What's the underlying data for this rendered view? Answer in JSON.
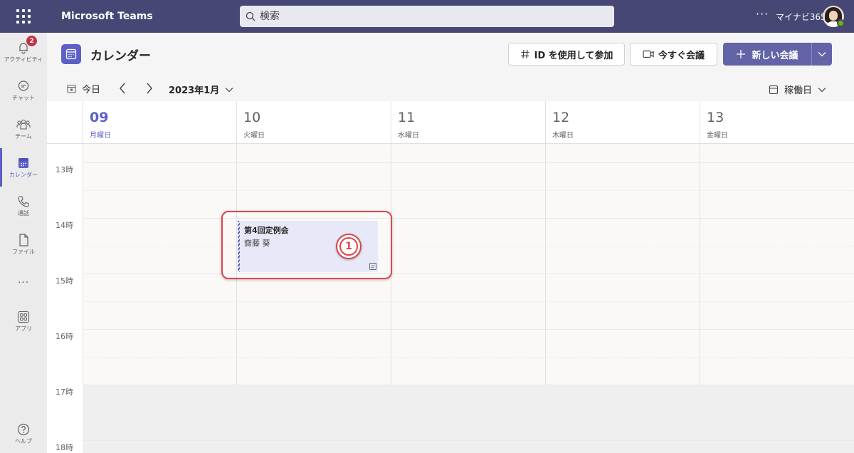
{
  "topbar": {
    "app_title": "Microsoft Teams",
    "search_placeholder": "検索",
    "more": "···",
    "user_name": "マイナビ365"
  },
  "rail": {
    "activity_badge": "2",
    "items": [
      {
        "label": "アクティビティ",
        "icon": "bell-icon"
      },
      {
        "label": "チャット",
        "icon": "chat-icon"
      },
      {
        "label": "チーム",
        "icon": "teams-icon"
      },
      {
        "label": "カレンダー",
        "icon": "calendar-icon"
      },
      {
        "label": "通話",
        "icon": "phone-icon"
      },
      {
        "label": "ファイル",
        "icon": "file-icon"
      },
      {
        "label": "···",
        "icon": "more-icon"
      },
      {
        "label": "アプリ",
        "icon": "apps-icon"
      },
      {
        "label": "ヘルプ",
        "icon": "help-icon"
      }
    ]
  },
  "header": {
    "title": "カレンダー",
    "join_label": "ID を使用して参加",
    "meet_now_label": "今すぐ会議",
    "new_meeting_label": "新しい会議"
  },
  "toolbar": {
    "today_label": "今日",
    "month_label": "2023年1月",
    "view_label": "稼働日"
  },
  "days": [
    {
      "num": "09",
      "name": "月曜日"
    },
    {
      "num": "10",
      "name": "火曜日"
    },
    {
      "num": "11",
      "name": "水曜日"
    },
    {
      "num": "12",
      "name": "木曜日"
    },
    {
      "num": "13",
      "name": "金曜日"
    }
  ],
  "hours": [
    "13時",
    "14時",
    "15時",
    "16時",
    "17時",
    "18時"
  ],
  "event": {
    "title": "第4回定例会",
    "organizer": "齋藤 葵"
  },
  "callout_number": "1",
  "colors": {
    "topbar": "#464775",
    "accent": "#5b5fc7",
    "highlight": "#d9474d"
  }
}
